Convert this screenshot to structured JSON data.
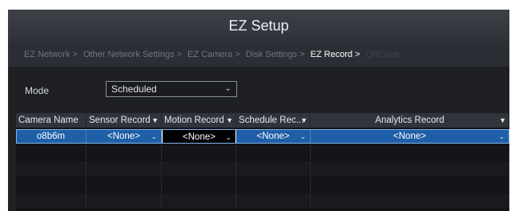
{
  "window": {
    "title": "EZ Setup"
  },
  "steps": [
    {
      "label": "EZ Network >",
      "state": "done"
    },
    {
      "label": "Other Network Settings >",
      "state": "done"
    },
    {
      "label": "EZ Camera >",
      "state": "done"
    },
    {
      "label": "Disk Settings >",
      "state": "done"
    },
    {
      "label": "EZ Record >",
      "state": "active"
    },
    {
      "label": "QRCode",
      "state": "future"
    }
  ],
  "mode": {
    "label": "Mode",
    "value": "Scheduled"
  },
  "table": {
    "columns": [
      "Camera Name",
      "Sensor Record",
      "Motion Record",
      "Schedule Rec...",
      "Analytics Record"
    ],
    "rows": [
      {
        "camera": "o8b6m",
        "sensor": "<None>",
        "motion": "<None>",
        "schedule": "<None>",
        "analytics": "<None>"
      }
    ]
  },
  "colors": {
    "accent": "#1f5fa7",
    "background": "#1f2024"
  }
}
